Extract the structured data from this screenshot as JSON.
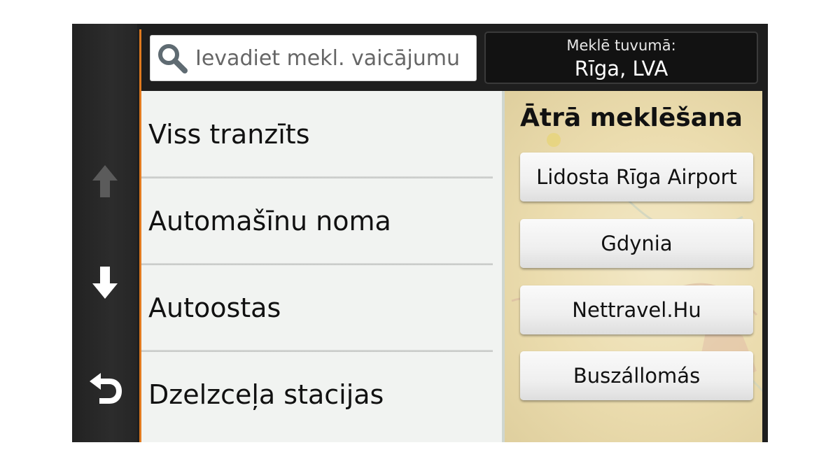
{
  "search": {
    "placeholder": "Ievadiet mekl. vaicājumu"
  },
  "near": {
    "label": "Meklē tuvumā:",
    "value": "Rīga, LVA"
  },
  "categories": [
    {
      "label": "Viss tranzīts"
    },
    {
      "label": "Automašīnu noma"
    },
    {
      "label": "Autoostas"
    },
    {
      "label": "Dzelzceļa stacijas"
    }
  ],
  "quick_search": {
    "title": "Ātrā meklēšana",
    "items": [
      {
        "label": "Lidosta Rīga Airport"
      },
      {
        "label": "Gdynia"
      },
      {
        "label": "Nettravel.Hu"
      },
      {
        "label": "Buszállomás"
      }
    ]
  },
  "nav": {
    "up_icon": "arrow-up-icon",
    "down_icon": "arrow-down-icon",
    "back_icon": "back-arrow-icon"
  },
  "colors": {
    "accent": "#e07a1f",
    "frame": "#1f1f1f",
    "list_bg": "#f1f3f1",
    "panel_bg": "#ebdcae"
  }
}
